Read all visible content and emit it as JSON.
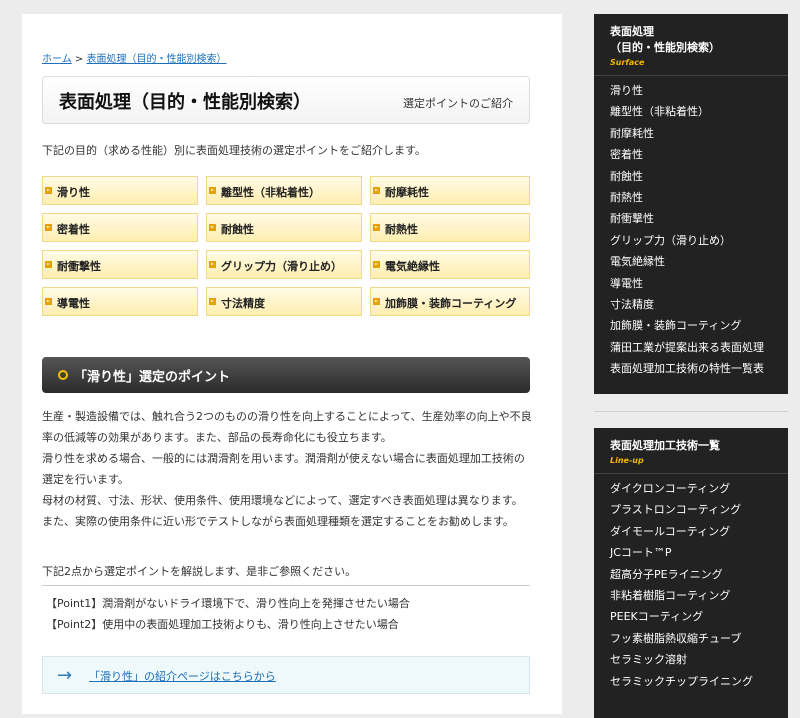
{
  "breadcrumb": {
    "home": "ホーム",
    "separator": ">",
    "current": "表面処理（目的・性能別検索）"
  },
  "page": {
    "title": "表面処理（目的・性能別検索）",
    "subtitle": "選定ポイントのご紹介",
    "intro": "下記の目的（求める性能）別に表面処理技術の選定ポイントをご紹介します。"
  },
  "categories": [
    "滑り性",
    "離型性（非粘着性）",
    "耐摩耗性",
    "密着性",
    "耐蝕性",
    "耐熱性",
    "耐衝撃性",
    "グリップ力（滑り止め）",
    "電気絶縁性",
    "導電性",
    "寸法精度",
    "加飾膜・装飾コーティング"
  ],
  "section": {
    "title": "「滑り性」選定のポイント",
    "paragraphs": [
      "生産・製造設備では、触れ合う2つのものの滑り性を向上することによって、生産効率の向上や不良率の低減等の効果があります。また、部品の長寿命化にも役立ちます。",
      "滑り性を求める場合、一般的には潤滑剤を用います。潤滑剤が使えない場合に表面処理加工技術の選定を行います。",
      "母材の材質、寸法、形状、使用条件、使用環境などによって、選定すべき表面処理は異なります。また、実際の使用条件に近い形でテストしながら表面処理種類を選定することをお勧めします。"
    ],
    "lead": "下記2点から選定ポイントを解説します、是非ご参照ください。",
    "points": [
      "【Point1】潤滑剤がないドライ環境下で、滑り性向上を発揮させたい場合",
      "【Point2】使用中の表面処理加工技術よりも、滑り性向上させたい場合"
    ],
    "link": "「滑り性」の紹介ページはこちらから"
  },
  "sidebar1": {
    "title_line1": "表面処理",
    "title_line2": "（目的・性能別検索）",
    "subtitle": "Surface",
    "items": [
      "滑り性",
      "離型性（非粘着性）",
      "耐摩耗性",
      "密着性",
      "耐蝕性",
      "耐熱性",
      "耐衝撃性",
      "グリップ力（滑り止め）",
      "電気絶縁性",
      "導電性",
      "寸法精度",
      "加飾膜・装飾コーティング",
      "蒲田工業が提案出来る表面処理",
      "表面処理加工技術の特性一覧表"
    ]
  },
  "sidebar2": {
    "title": "表面処理加工技術一覧",
    "subtitle": "Line-up",
    "items": [
      "ダイクロンコーティング",
      "プラストロンコーティング",
      "ダイモールコーティング",
      "JCコート™P",
      "超高分子PEライニング",
      "非粘着樹脂コーティング",
      "PEEKコーティング",
      "フッ素樹脂熱収縮チューブ",
      "セラミック溶射",
      "セラミックチップライニング"
    ]
  },
  "colors": {
    "accent_yellow": "#f3b600",
    "link_blue": "#1d6fb8",
    "sidebar_bg": "#222222"
  }
}
